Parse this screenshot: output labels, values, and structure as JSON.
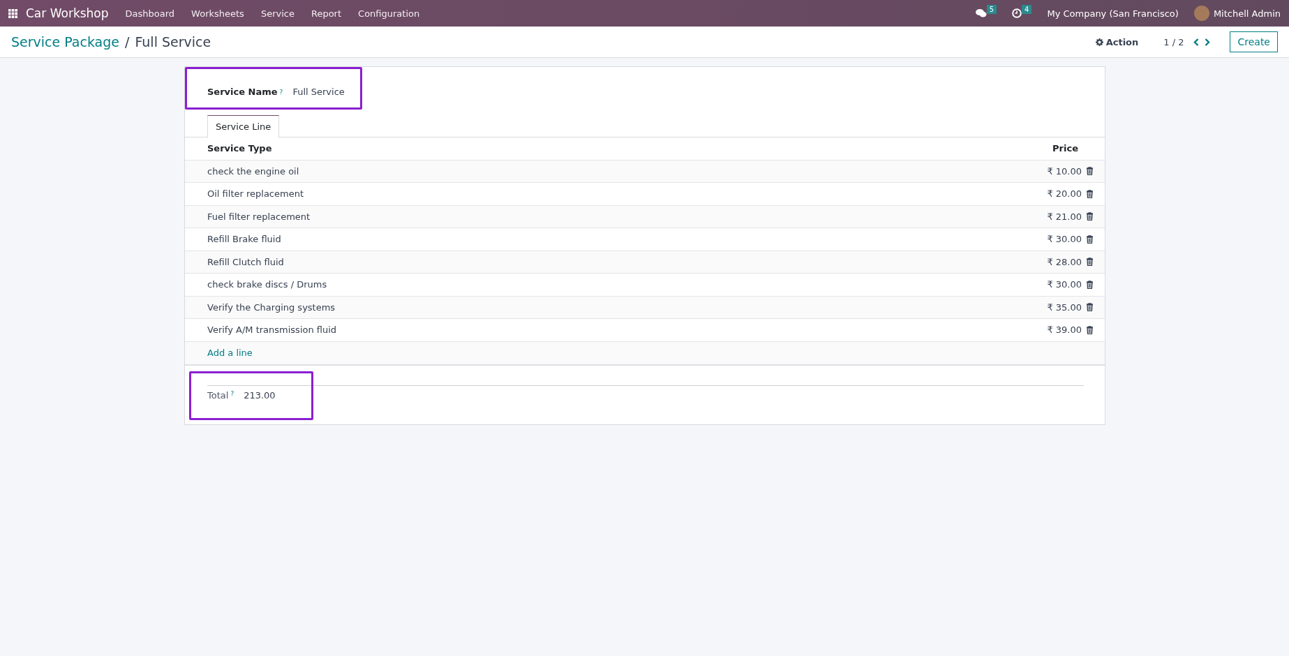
{
  "navbar": {
    "app_name": "Car Workshop",
    "menu": [
      "Dashboard",
      "Worksheets",
      "Service",
      "Report",
      "Configuration"
    ],
    "messages_count": "5",
    "activities_count": "4",
    "company": "My Company (San Francisco)",
    "user": "Mitchell Admin"
  },
  "control_panel": {
    "breadcrumb": [
      "Service Package",
      "Full Service"
    ],
    "breadcrumb_separator": "/",
    "action_label": "Action",
    "pager": "1 / 2",
    "create_label": "Create"
  },
  "form": {
    "service_name_label": "Service Name",
    "service_name_help": "?",
    "service_name_value": "Full Service",
    "tabs": [
      {
        "label": "Service Line",
        "selected": true
      }
    ],
    "columns": [
      "Service Type",
      "Price"
    ],
    "rows": [
      {
        "service_type": "check the engine oil",
        "price": "₹ 10.00"
      },
      {
        "service_type": "Oil filter replacement",
        "price": "₹ 20.00"
      },
      {
        "service_type": "Fuel filter replacement",
        "price": "₹ 21.00"
      },
      {
        "service_type": "Refill Brake fluid",
        "price": "₹ 30.00"
      },
      {
        "service_type": "Refill Clutch fluid",
        "price": "₹ 28.00"
      },
      {
        "service_type": "check brake discs / Drums",
        "price": "₹ 30.00"
      },
      {
        "service_type": "Verify the Charging systems",
        "price": "₹ 35.00"
      },
      {
        "service_type": "Verify A/M transmission fluid",
        "price": "₹ 39.00"
      }
    ],
    "add_line": "Add a line",
    "total_label": "Total",
    "total_help": "?",
    "total_value": "213.00"
  }
}
